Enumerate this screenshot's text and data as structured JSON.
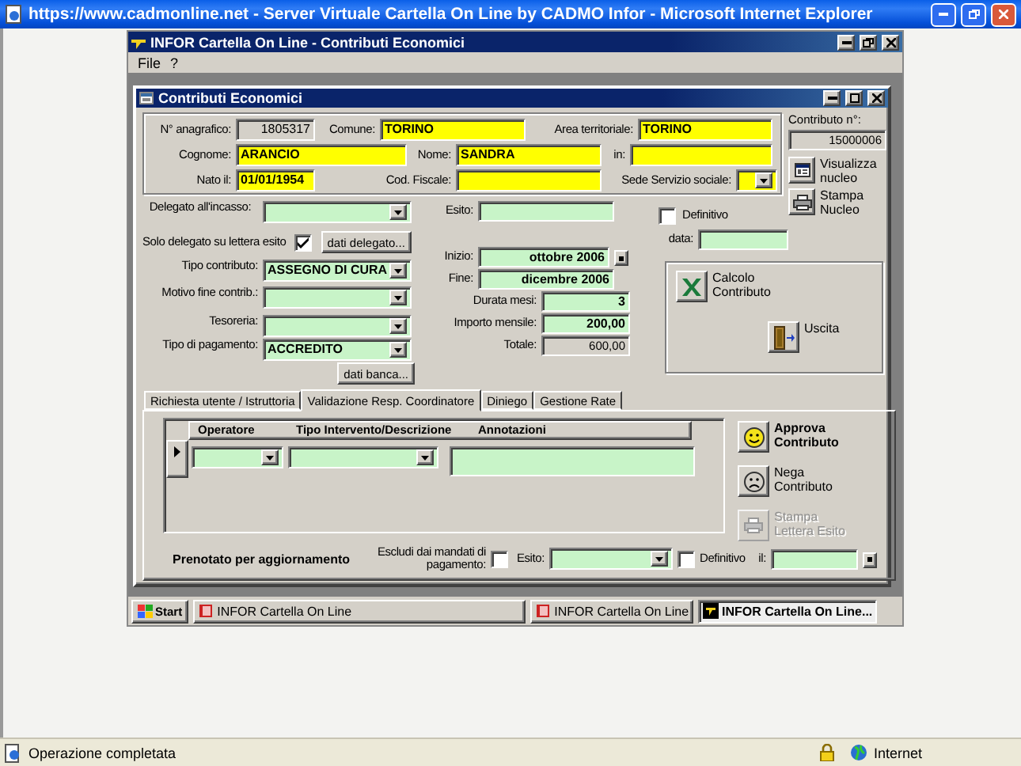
{
  "browser": {
    "title": "https://www.cadmonline.net - Server Virtuale Cartella On Line by CADMO Infor - Microsoft Internet Explorer",
    "status": "Operazione completata",
    "zone": "Internet"
  },
  "app": {
    "title": "INFOR Cartella On Line - Contributi Economici",
    "menu": [
      "File",
      "?"
    ]
  },
  "form": {
    "title": "Contributi Economici",
    "header_rows": [
      {
        "fields": [
          {
            "label": "N° anagrafico:",
            "value": "1805317",
            "kind": "readonly"
          },
          {
            "label": "Comune:",
            "value": "TORINO",
            "kind": "text"
          },
          {
            "label": "Area territoriale:",
            "value": "TORINO",
            "kind": "text"
          }
        ]
      },
      {
        "fields": [
          {
            "label": "Cognome:",
            "value": "ARANCIO",
            "kind": "text"
          },
          {
            "label": "Nome:",
            "value": "SANDRA",
            "kind": "text"
          },
          {
            "label": "in:",
            "kind": "text"
          }
        ]
      },
      {
        "fields": [
          {
            "label": "Nato il:",
            "value": "01/01/1954",
            "kind": "text"
          },
          {
            "label": "Cod. Fiscale:",
            "kind": "text"
          },
          {
            "label": "Sede Servizio sociale:",
            "kind": "combo"
          }
        ]
      }
    ],
    "contributo": {
      "label": "Contributo n°:",
      "value": "15000006"
    },
    "side_buttons": [
      {
        "label": "Visualizza nucleo",
        "kind": "family"
      },
      {
        "label": "Stampa Nucleo",
        "kind": "print"
      }
    ],
    "left_fields": [
      {
        "kind": "combo",
        "label": "Delegato all'incasso:"
      },
      {
        "kind": "checkbox",
        "label": "Solo delegato su lettera esito",
        "checked": true,
        "button": "dati delegato..."
      },
      {
        "kind": "combo",
        "label": "Tipo contributo:",
        "value": "ASSEGNO DI CURA"
      },
      {
        "kind": "combo",
        "label": "Motivo fine contrib.:"
      },
      {
        "kind": "combo",
        "label": "Tesoreria:"
      },
      {
        "kind": "combo",
        "label": "Tipo di pagamento:",
        "value": "ACCREDITO"
      },
      {
        "kind": "button",
        "label": "dati banca..."
      }
    ],
    "middle_fields": [
      {
        "kind": "text",
        "label": "Esito:"
      },
      {
        "kind": "spin",
        "label": "Inizio:",
        "value": "ottobre 2006"
      },
      {
        "kind": "text",
        "label": "Fine:",
        "value": "dicembre 2006"
      },
      {
        "kind": "text",
        "label": "Durata mesi:",
        "value": "3"
      },
      {
        "kind": "text",
        "label": "Importo mensile:",
        "value": "200,00"
      },
      {
        "kind": "readonly",
        "label": "Totale:",
        "value": "600,00"
      }
    ],
    "definitivo": {
      "label": "Definitivo",
      "checked": false
    },
    "data": {
      "label": "data:"
    },
    "action_buttons": [
      {
        "label": "Calcolo Contributo",
        "kind": "calc"
      },
      {
        "label": "Uscita",
        "kind": "exit"
      }
    ],
    "tabs": [
      {
        "label": "Richiesta utente / Istruttoria",
        "selected": false
      },
      {
        "label": "Validazione Resp. Coordinatore",
        "selected": true
      },
      {
        "label": "Diniego",
        "selected": false
      },
      {
        "label": "Gestione Rate",
        "selected": false
      }
    ],
    "grid": {
      "columns": [
        "Operatore",
        "Tipo Intervento/Descrizione",
        "Annotazioni"
      ]
    },
    "decision_buttons": [
      {
        "label": "Approva Contributo",
        "kind": "approve",
        "bold": true,
        "disabled": false
      },
      {
        "label": "Nega Contributo",
        "kind": "deny",
        "bold": false,
        "disabled": false
      },
      {
        "label": "Stampa Lettera Esito",
        "kind": "print",
        "bold": false,
        "disabled": true
      }
    ],
    "bottom": {
      "title": "Prenotato per aggiornamento",
      "exclude": {
        "label": "Escludi dai mandati di pagamento:",
        "checked": false
      },
      "esito": {
        "label": "Esito:"
      },
      "definitivo": {
        "label": "Definitivo",
        "checked": false
      },
      "date": {
        "label": "il:"
      }
    }
  },
  "taskbar": {
    "start": "Start",
    "items": [
      {
        "label": "INFOR Cartella On Line",
        "selected": false
      },
      {
        "label": "INFOR Cartella On Line",
        "selected": false
      },
      {
        "label": "INFOR Cartella On Line...",
        "selected": true
      }
    ]
  }
}
